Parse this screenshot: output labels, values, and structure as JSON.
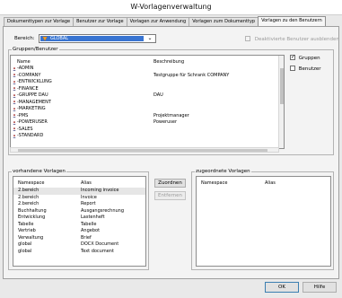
{
  "window": {
    "title": "W-Vorlagenverwaltung"
  },
  "tabs": [
    {
      "label": "Dokumenttypen zur Vorlage"
    },
    {
      "label": "Benutzer zur Vorlage"
    },
    {
      "label": "Vorlagen zur Anwendung"
    },
    {
      "label": "Vorlagen zum Dokumenttyp"
    },
    {
      "label": "Vorlagen zu den Benutzern"
    }
  ],
  "bereich": {
    "label": "Bereich:",
    "selected": "GLOBAL"
  },
  "hide_disabled": {
    "label": "Deaktivierte Benutzer ausblenden",
    "checked": false
  },
  "groups_users": {
    "title": "Gruppen/Benutzer",
    "columns": {
      "name": "Name",
      "description": "Beschreibung"
    },
    "rows": [
      {
        "name": "ADMIN",
        "description": ""
      },
      {
        "name": "COMPANY",
        "description": "Testgruppe für Schrank COMPANY"
      },
      {
        "name": "ENTWICKLUNG",
        "description": ""
      },
      {
        "name": "FINANCE",
        "description": ""
      },
      {
        "name": "GRUPPE DAU",
        "description": "DAU"
      },
      {
        "name": "MANAGEMENT",
        "description": ""
      },
      {
        "name": "MARKETING",
        "description": ""
      },
      {
        "name": "PMS",
        "description": "Projektmanager"
      },
      {
        "name": "POWERUSER",
        "description": "Poweruser"
      },
      {
        "name": "SALES",
        "description": ""
      },
      {
        "name": "STANDARD",
        "description": ""
      }
    ],
    "filter_groups": {
      "label": "Gruppen",
      "checked": true
    },
    "filter_users": {
      "label": "Benutzer",
      "checked": false
    }
  },
  "available": {
    "title": "vorhandene Vorlagen",
    "columns": {
      "namespace": "Namespace",
      "alias": "Alias"
    },
    "rows": [
      {
        "namespace": "2.bereich",
        "alias": "Incoming invoice"
      },
      {
        "namespace": "2.bereich",
        "alias": "Invoice"
      },
      {
        "namespace": "2.bereich",
        "alias": "Report"
      },
      {
        "namespace": "Buchhaltung",
        "alias": "Ausgangsrechnung"
      },
      {
        "namespace": "Entwicklung",
        "alias": "Lastenheft"
      },
      {
        "namespace": "Tabelle",
        "alias": "Tabelle"
      },
      {
        "namespace": "Vertrieb",
        "alias": "Angebot"
      },
      {
        "namespace": "Verwaltung",
        "alias": "Brief"
      },
      {
        "namespace": "global",
        "alias": "DOCX Document"
      },
      {
        "namespace": "global",
        "alias": "Text document"
      }
    ]
  },
  "assigned": {
    "title": "zugeordnete Vorlagen",
    "columns": {
      "namespace": "Namespace",
      "alias": "Alias"
    },
    "rows": []
  },
  "actions": {
    "assign": "Zuordnen",
    "remove": "Entfernen"
  },
  "footer": {
    "ok": "OK",
    "help": "Hilfe"
  }
}
